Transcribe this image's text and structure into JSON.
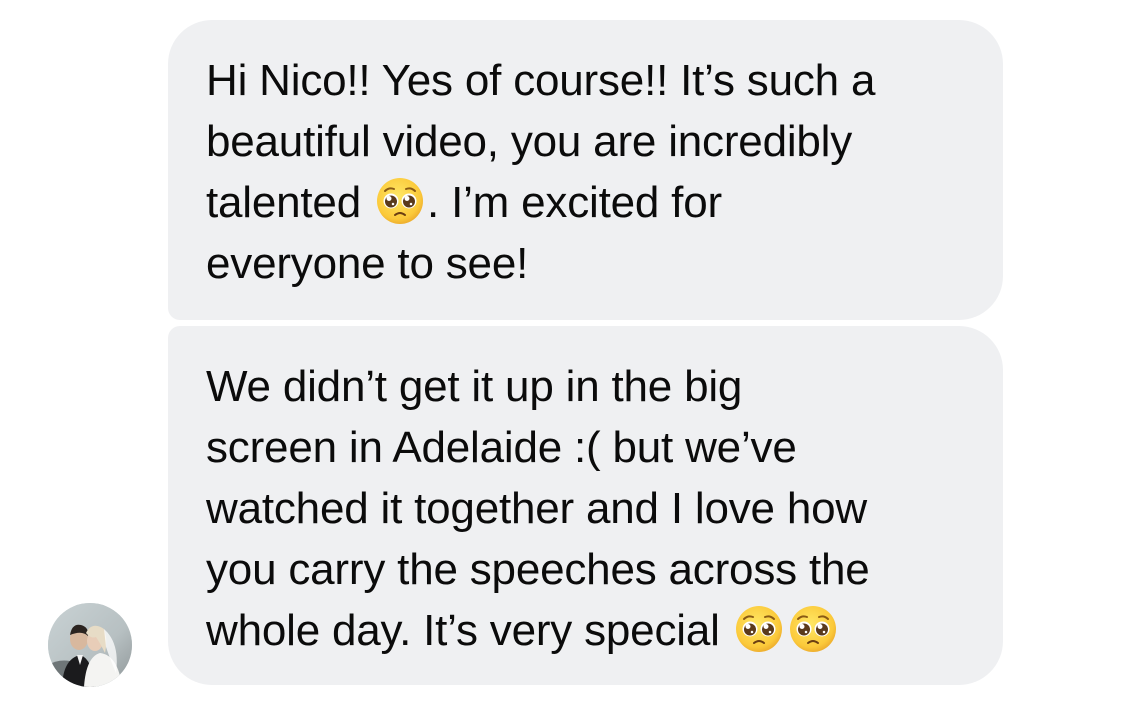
{
  "thread": {
    "messages": [
      {
        "lines": [
          {
            "before": "Hi Nico!! Yes of course!! It’s such a",
            "emoji_count": 0,
            "after": ""
          },
          {
            "before": "beautiful video, you are incredibly",
            "emoji_count": 0,
            "after": ""
          },
          {
            "before": "talented ",
            "emoji_count": 1,
            "after": ". I’m excited for"
          },
          {
            "before": "everyone to see!",
            "emoji_count": 0,
            "after": ""
          }
        ]
      },
      {
        "lines": [
          {
            "before": "We didn’t get it up in the big",
            "emoji_count": 0,
            "after": ""
          },
          {
            "before": "screen in Adelaide :( but we’ve",
            "emoji_count": 0,
            "after": ""
          },
          {
            "before": "watched it together and I love how",
            "emoji_count": 0,
            "after": ""
          },
          {
            "before": "you carry the speeches across the",
            "emoji_count": 0,
            "after": ""
          },
          {
            "before": "whole day. It’s very special ",
            "emoji_count": 2,
            "after": ""
          }
        ]
      }
    ],
    "emoji_name": "pleading-face-emoji",
    "avatar_name": "sender-avatar"
  },
  "colors": {
    "bubble_background": "#eff0f2",
    "text": "#0b0b0b",
    "page_background": "#ffffff"
  }
}
